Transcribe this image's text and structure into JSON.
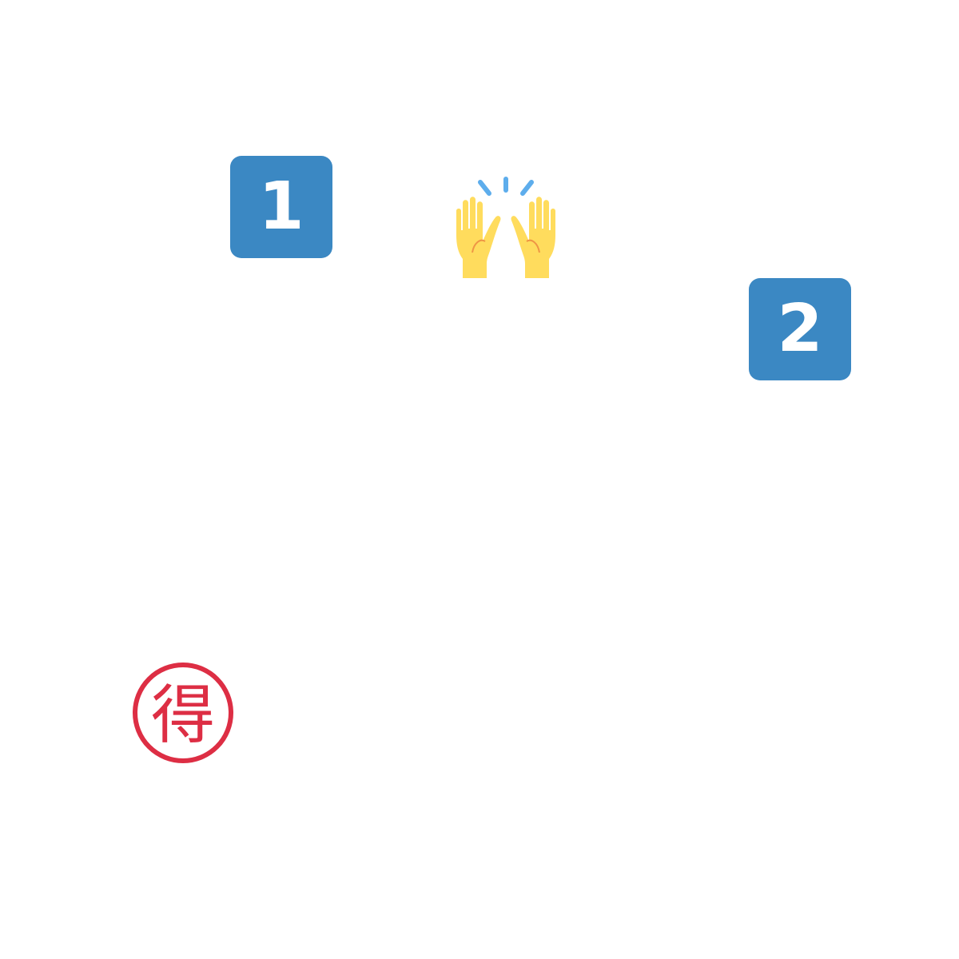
{
  "colors": {
    "background": "#ffffff",
    "keycap": "#3b88c3",
    "keycap_text": "#ffffff",
    "hands_skin": "#ffdc5d",
    "hands_line": "#ef9645",
    "sparkle": "#5dadec",
    "seal_red": "#dd2e44"
  },
  "items": {
    "keycap_one": {
      "icon": "keycap-digit-one-icon",
      "label": "1"
    },
    "raising_hands": {
      "icon": "raising-hands-icon"
    },
    "keycap_two": {
      "icon": "keycap-digit-two-icon",
      "label": "2"
    },
    "bargain_seal": {
      "icon": "japanese-bargain-button-icon",
      "label": "得"
    }
  }
}
